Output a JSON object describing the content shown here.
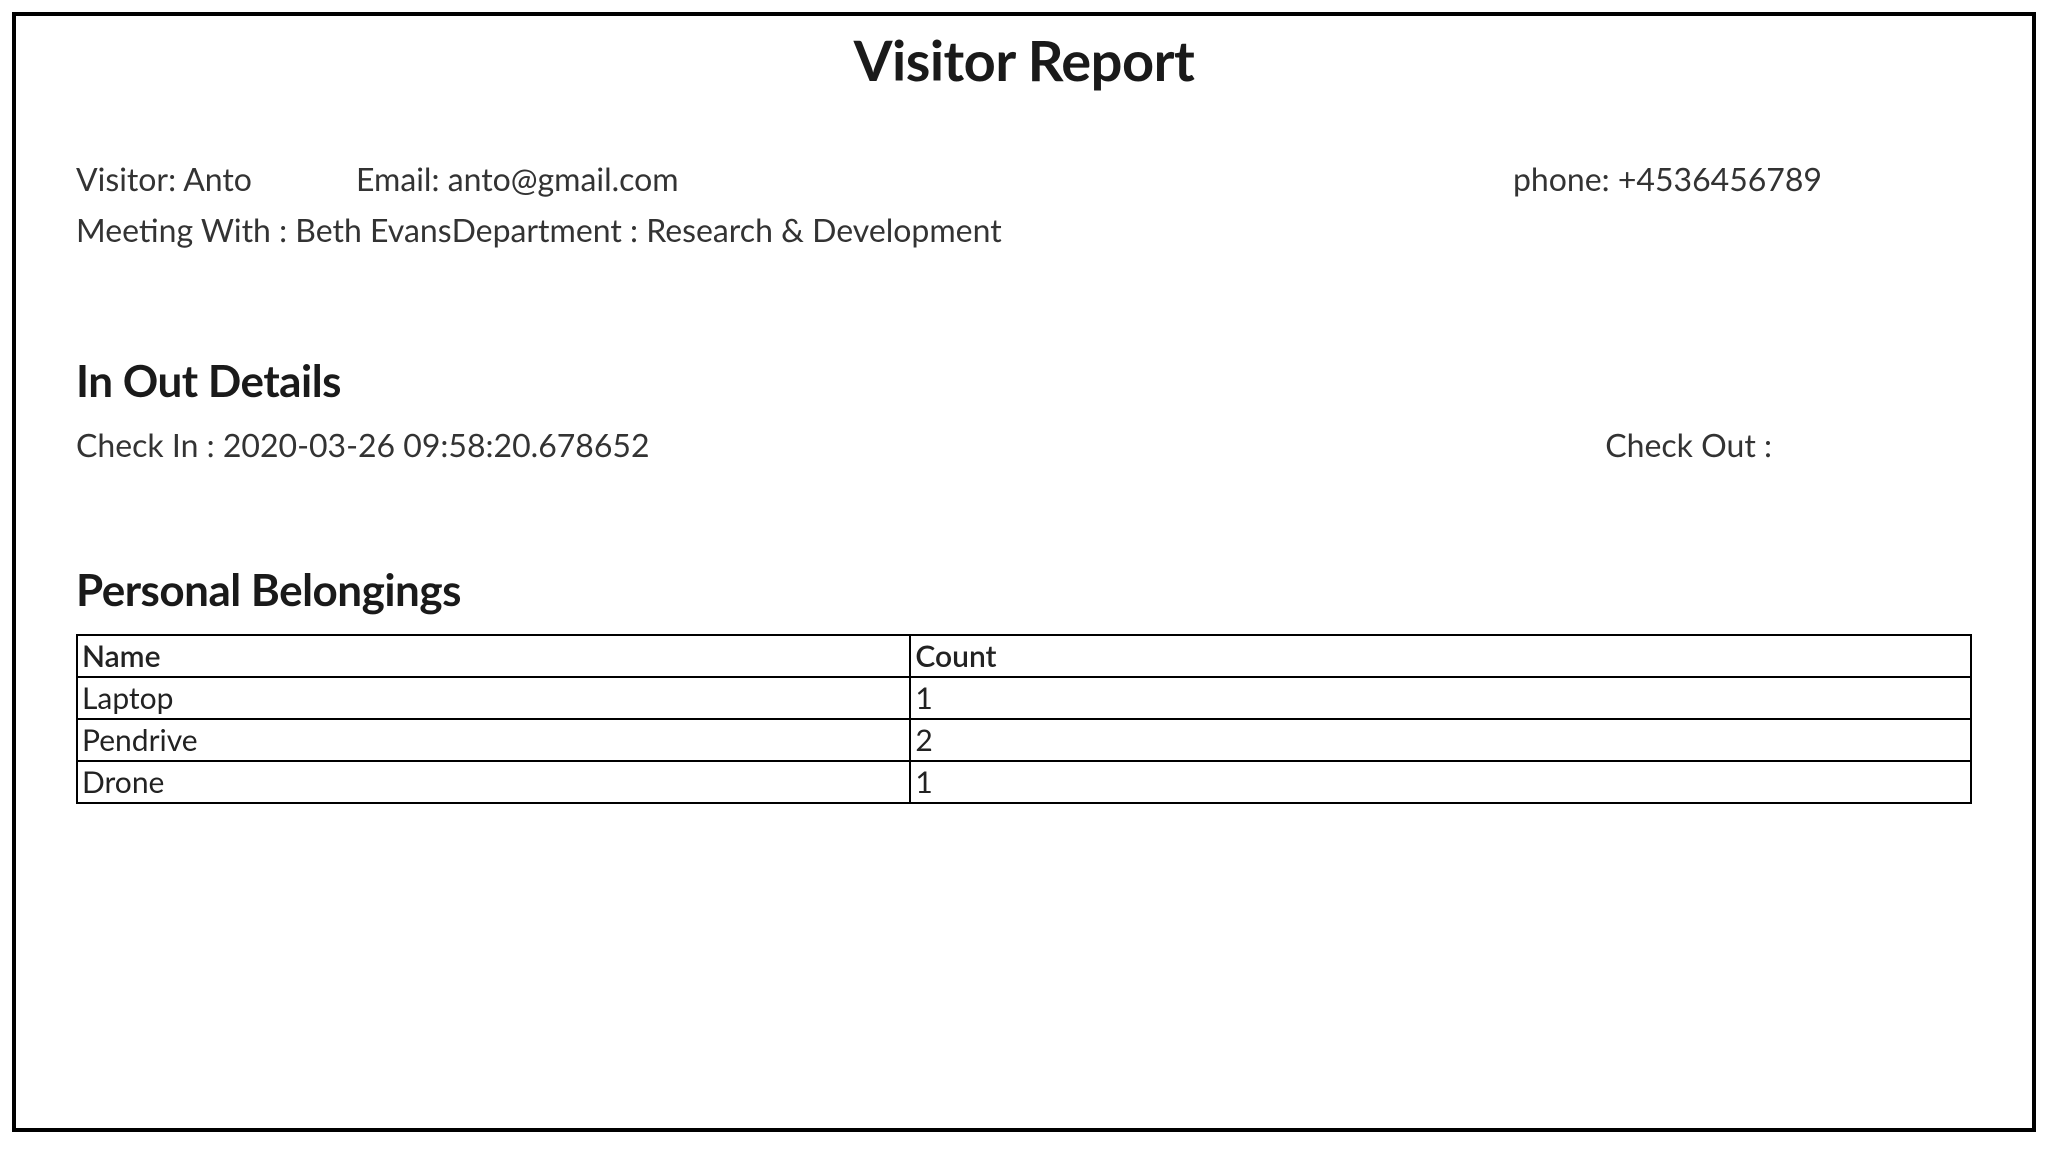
{
  "report": {
    "title": "Visitor Report"
  },
  "visitor_info": {
    "visitor_label": "Visitor: ",
    "visitor_value": "Anto",
    "email_label": "Email: ",
    "email_value": "anto@gmail.com",
    "phone_label": "phone: ",
    "phone_value": "+4536456789",
    "meeting_label": "Meeting With : ",
    "meeting_value": "Beth Evans",
    "department_label": "Department : ",
    "department_value": "Research & Development"
  },
  "inout": {
    "heading": "In Out Details",
    "checkin_label": "Check In : ",
    "checkin_value": "2020-03-26 09:58:20.678652",
    "checkout_label": "Check Out :",
    "checkout_value": ""
  },
  "belongings": {
    "heading": "Personal Belongings",
    "headers": {
      "name": "Name",
      "count": "Count"
    },
    "rows": [
      {
        "name": "Laptop",
        "count": "1"
      },
      {
        "name": "Pendrive",
        "count": "2"
      },
      {
        "name": "Drone",
        "count": "1"
      }
    ]
  }
}
